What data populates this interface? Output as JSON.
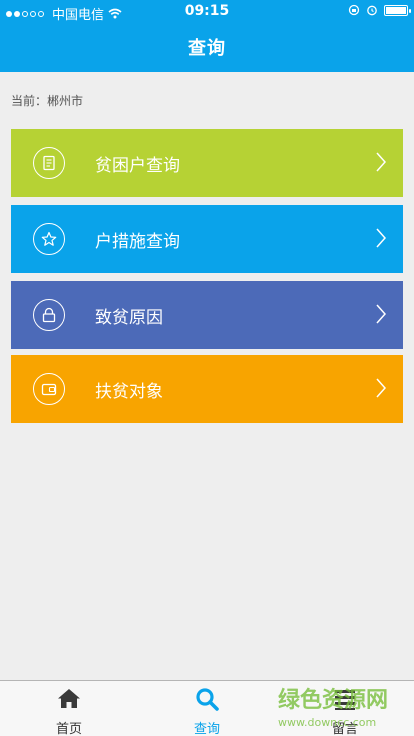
{
  "status_bar": {
    "carrier": "中国电信",
    "time": "09:15"
  },
  "header": {
    "title": "查询"
  },
  "location": {
    "text": "当前：郴州市"
  },
  "menu": [
    {
      "label": "贫困户查询",
      "color": "#b6d234",
      "icon": "document-icon"
    },
    {
      "label": "户措施查询",
      "color": "#0aa3ea",
      "icon": "star-icon"
    },
    {
      "label": "致贫原因",
      "color": "#4c6ab8",
      "icon": "lock-icon"
    },
    {
      "label": "扶贫对象",
      "color": "#f8a400",
      "icon": "wallet-icon"
    }
  ],
  "tabbar": {
    "items": [
      {
        "label": "首页",
        "icon": "home-icon"
      },
      {
        "label": "查询",
        "icon": "search-icon"
      },
      {
        "label": "留言",
        "icon": "list-icon"
      }
    ]
  },
  "watermark": {
    "text": "绿色资源网",
    "url": "www.downcc.com"
  },
  "colors": {
    "accent": "#0aa3ea",
    "background": "#eeeeee"
  }
}
